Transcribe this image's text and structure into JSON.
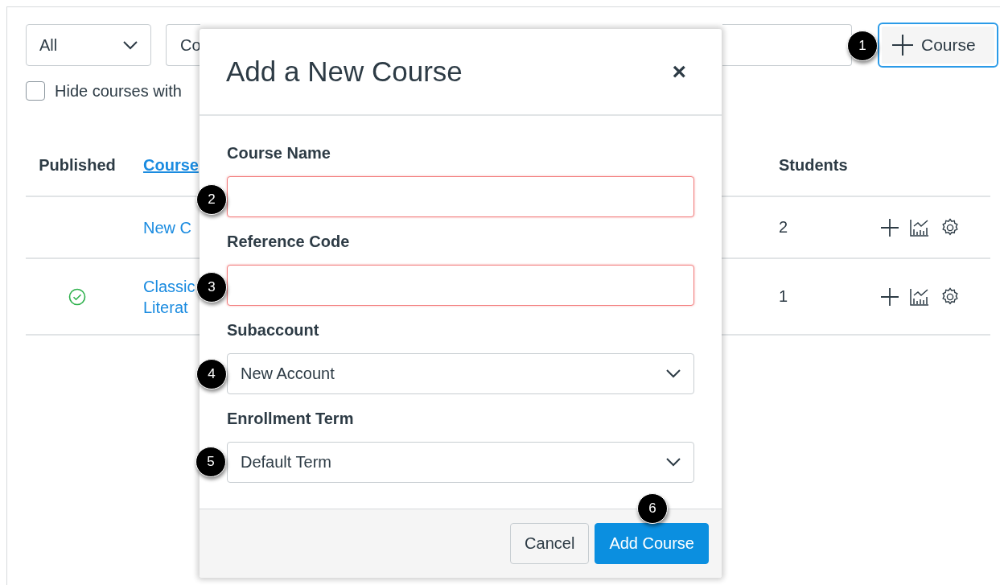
{
  "filters": {
    "state_select": "All",
    "type_select": "Co",
    "hide_checkbox": {
      "label": "Hide courses with",
      "checked": false
    },
    "add_button": "Course"
  },
  "table": {
    "columns": [
      "Published",
      "Course",
      "Students"
    ],
    "rows": [
      {
        "published": false,
        "course": [
          "New C"
        ],
        "students": "2"
      },
      {
        "published": true,
        "course": [
          "Classic",
          "Literat"
        ],
        "students": "1"
      }
    ]
  },
  "dialog": {
    "title": "Add a New Course",
    "close": "×",
    "fields": [
      {
        "kind": "text",
        "label": "Course Name",
        "invalid": true
      },
      {
        "kind": "text",
        "label": "Reference Code",
        "invalid": true
      },
      {
        "kind": "select",
        "label": "Subaccount",
        "value": "New Account"
      },
      {
        "kind": "select",
        "label": "Enrollment Term",
        "value": "Default Term"
      }
    ],
    "buttons": [
      {
        "label": "Cancel",
        "primary": false
      },
      {
        "label": "Add Course",
        "primary": true
      }
    ]
  },
  "callouts": [
    "1",
    "2",
    "3",
    "4",
    "5",
    "6"
  ]
}
